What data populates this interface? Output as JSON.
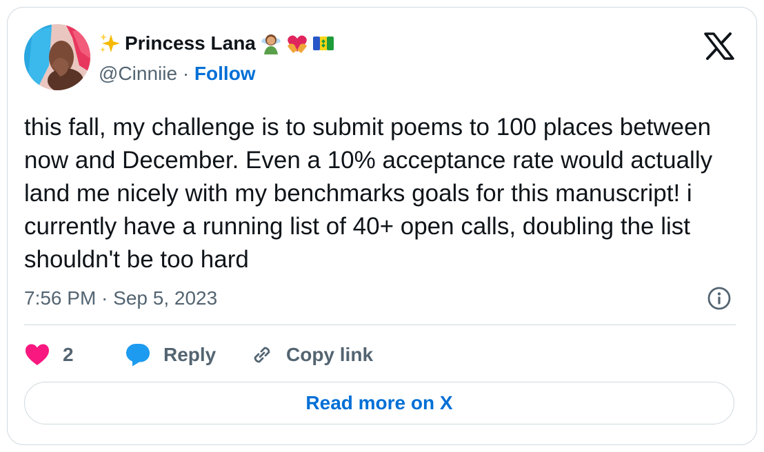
{
  "author": {
    "display_name": "Princess Lana",
    "handle": "@Cinniie",
    "separator": "·",
    "follow_label": "Follow",
    "name_emojis": [
      "sparkles-emoji",
      "person-woman-emoji",
      "heart-hands-emoji",
      "saint-vincent-flag-emoji"
    ]
  },
  "tweet": {
    "text": "this fall, my challenge is to submit poems to 100 places between now and December. Even a 10% acceptance rate would actually land me nicely with my benchmarks goals for this manuscript! i currently have a running list of 40+ open calls, doubling the list shouldn't be too hard",
    "timestamp": "7:56 PM · Sep 5, 2023"
  },
  "actions": {
    "like_count": "2",
    "reply_label": "Reply",
    "copy_label": "Copy link"
  },
  "read_more_label": "Read more on X",
  "colors": {
    "like": "#f91880",
    "reply": "#1d9bf0",
    "link": "#006fd6",
    "muted": "#536471",
    "border": "#cfd9de"
  },
  "icons": {
    "brand": "x-logo-icon",
    "info": "info-icon",
    "like": "heart-icon",
    "reply": "speech-bubble-icon",
    "copy": "link-icon"
  }
}
